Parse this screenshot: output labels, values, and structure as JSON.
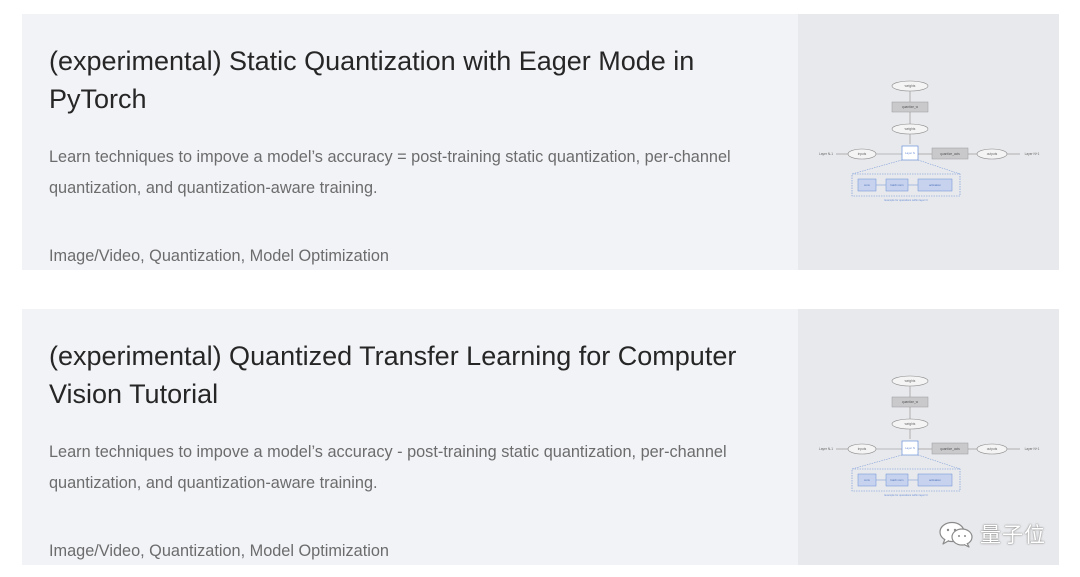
{
  "cards": [
    {
      "title": "(experimental) Static Quantization with Eager Mode in PyTorch",
      "summary": "Learn techniques to impove a model’s accuracy = post-training static quantization, per-channel quantization, and quantization-aware training.",
      "tags": "Image/Video, Quantization, Model Optimization",
      "diagram": {
        "weights_in": "weights",
        "quantize_top": "quantize_w",
        "weights_q": "weights",
        "layer_in": "Layer N-1",
        "inputs": "inputs",
        "layer": "Layer N",
        "quantize_act": "quantize_acts",
        "outputs": "outputs",
        "layer_out": "Layer N+1",
        "sub_conv": "conv",
        "sub_bn": "batch norm",
        "sub_act": "activation",
        "caption": "Example for operations within layer N"
      }
    },
    {
      "title": "(experimental) Quantized Transfer Learning for Computer Vision Tutorial",
      "summary": "Learn techniques to impove a model’s accuracy - post-training static quantization, per-channel quantization, and quantization-aware training.",
      "tags": "Image/Video, Quantization, Model Optimization",
      "diagram": {
        "weights_in": "weights",
        "quantize_top": "quantize_w",
        "weights_q": "weights",
        "layer_in": "Layer N-1",
        "inputs": "inputs",
        "layer": "Layer N",
        "quantize_act": "quantize_acts",
        "outputs": "outputs",
        "layer_out": "Layer N+1",
        "sub_conv": "conv",
        "sub_bn": "batch norm",
        "sub_act": "activation",
        "caption": "Example for operations within layer N"
      }
    }
  ],
  "watermark": {
    "text": "量子位",
    "icon": "wechat-icon"
  },
  "colors": {
    "card_bg": "#f2f3f7",
    "image_bg": "#e8e9ec",
    "title": "#262626",
    "body_text": "#6c6c6d",
    "diagram_blue": "#6a8fd8"
  }
}
